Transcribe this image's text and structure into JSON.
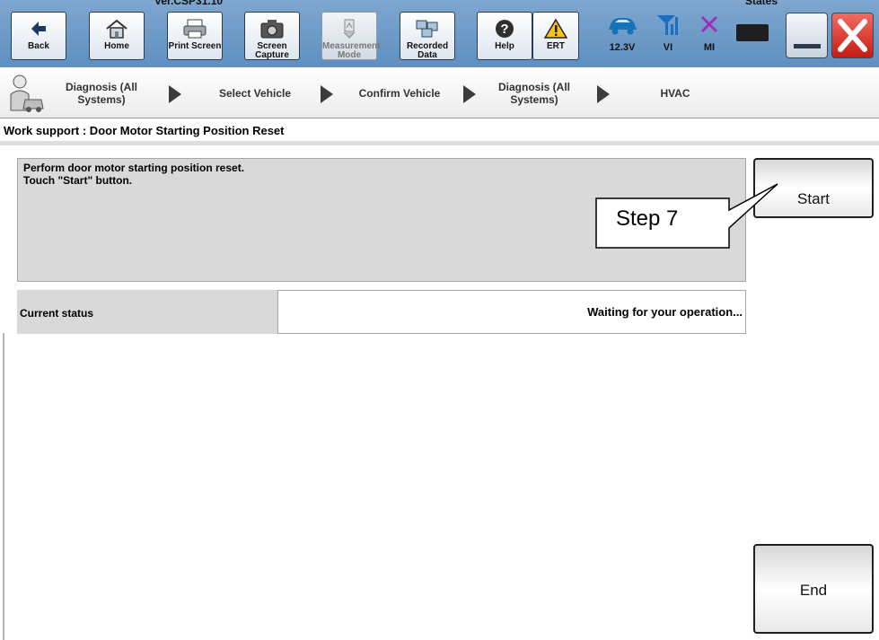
{
  "toolbar": {
    "version_text": "Ver.CSP31.10",
    "states_text": "States",
    "buttons": [
      {
        "label": "Back",
        "icon": "back-arrow-icon"
      },
      {
        "label": "Home",
        "icon": "home-icon"
      },
      {
        "label": "Print Screen",
        "icon": "printer-icon"
      },
      {
        "label": "Screen Capture",
        "icon": "camera-icon"
      },
      {
        "label": "Measurement Mode",
        "icon": "measurement-icon"
      },
      {
        "label": "Recorded Data",
        "icon": "recorded-data-icon"
      },
      {
        "label": "Help",
        "icon": "help-icon"
      },
      {
        "label": "ERT",
        "icon": "warning-icon"
      }
    ],
    "status": {
      "battery_voltage": "12.3V",
      "vi_label": "VI",
      "mi_label": "MI"
    }
  },
  "breadcrumb": [
    "Diagnosis (All Systems)",
    "Select Vehicle",
    "Confirm Vehicle",
    "Diagnosis (All Systems)",
    "HVAC"
  ],
  "work_support": {
    "title": "Work support : Door Motor Starting Position Reset",
    "message_line1": "Perform door motor starting position reset.",
    "message_line2": "Touch \"Start\" button.",
    "current_status_label": "Current status",
    "current_status_value": "Waiting for your operation...",
    "start_label": "Start",
    "end_label": "End"
  },
  "callout": {
    "text": "Step 7"
  },
  "colors": {
    "toolbar_bg": "#6f99c8",
    "panel_gray": "#d9d9d9",
    "close_red": "#d9291f"
  }
}
